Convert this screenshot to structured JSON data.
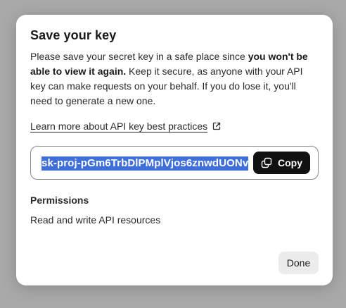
{
  "dialog": {
    "title": "Save your key",
    "description": {
      "part1": "Please save your secret key in a safe place since ",
      "bold": "you won't be able to view it again.",
      "part2": " Keep it secure, as anyone with your API key can make requests on your behalf. If you do lose it, you'll need to generate a new one."
    },
    "learn_more_link": "Learn more about API key best practices",
    "key_value": "sk-proj-pGm6TrbDlPMplVjos6znwdUONv",
    "copy_label": "Copy",
    "permissions_heading": "Permissions",
    "permissions_value": "Read and write API resources",
    "done_label": "Done"
  },
  "icons": {
    "external_link": "external-link-icon",
    "copy": "copy-icon"
  },
  "colors": {
    "overlay": "#a9a9a9",
    "selection_highlight": "#3f6fd9",
    "copy_button_bg": "#111111",
    "done_button_bg": "#ececec"
  }
}
